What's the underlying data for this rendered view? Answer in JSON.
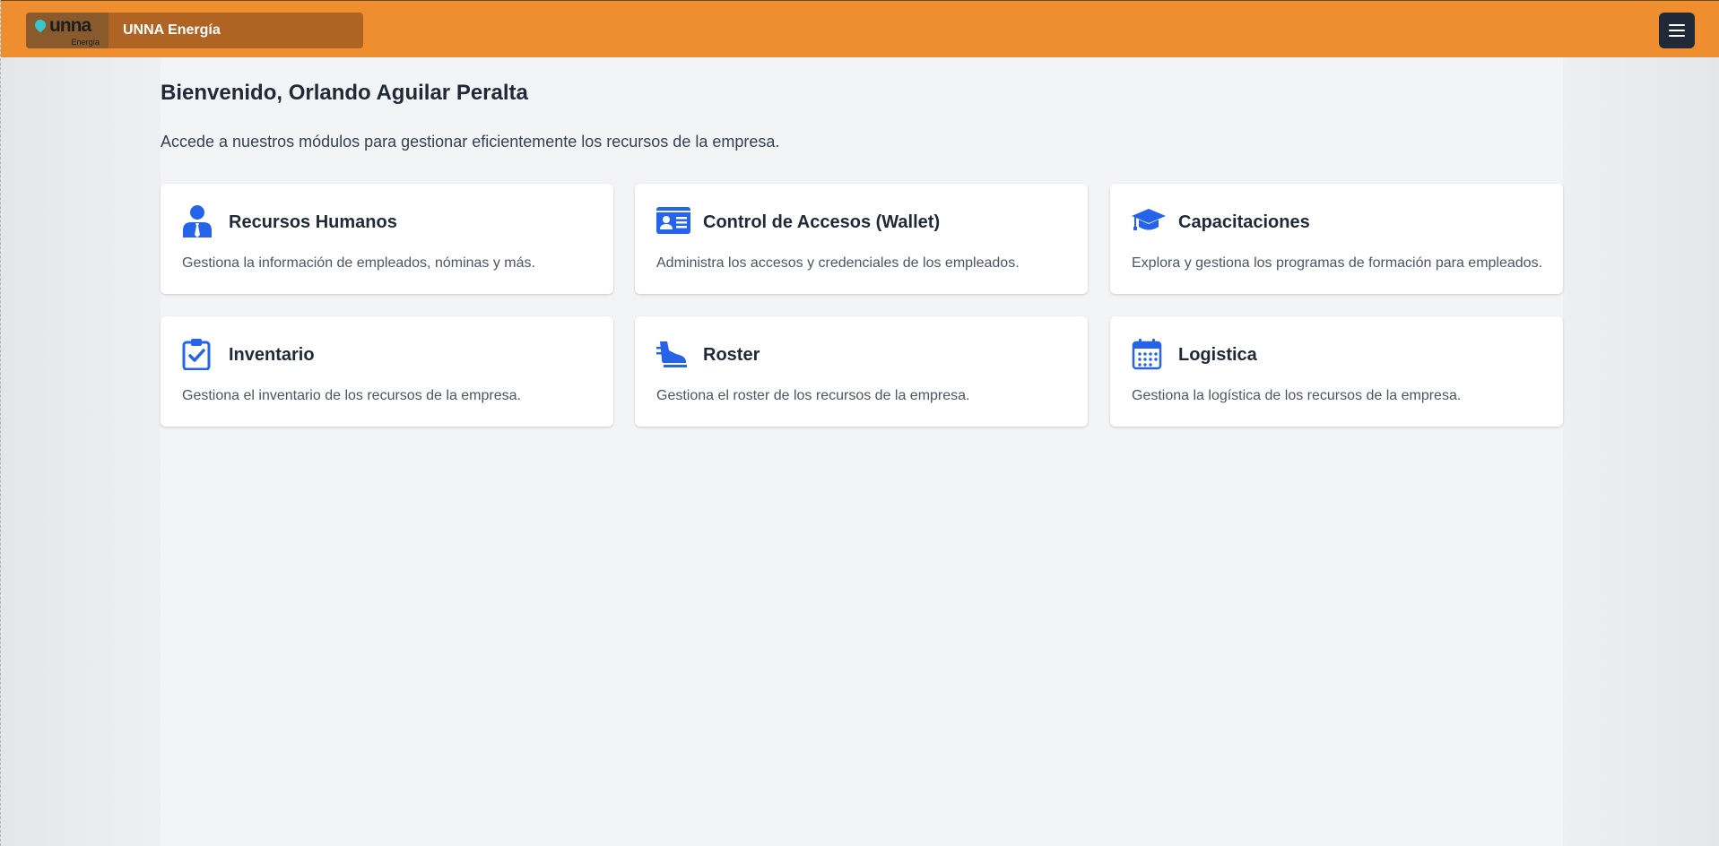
{
  "header": {
    "logo_text": "unna",
    "logo_subtext": "Energía",
    "brand_name": "UNNA Energía",
    "menu_icon": "hamburger-icon"
  },
  "main": {
    "welcome": "Bienvenido, Orlando Aguilar Peralta",
    "subtitle": "Accede a nuestros módulos para gestionar eficientemente los recursos de la empresa.",
    "modules": [
      {
        "title": "Recursos Humanos",
        "description": "Gestiona la información de empleados, nóminas y más.",
        "icon": "user-tie-icon"
      },
      {
        "title": "Control de Accesos (Wallet)",
        "description": "Administra los accesos y credenciales de los empleados.",
        "icon": "id-card-icon"
      },
      {
        "title": "Capacitaciones",
        "description": "Explora y gestiona los programas de formación para empleados.",
        "icon": "graduation-cap-icon"
      },
      {
        "title": "Inventario",
        "description": "Gestiona el inventario de los recursos de la empresa.",
        "icon": "clipboard-check-icon"
      },
      {
        "title": "Roster",
        "description": "Gestiona el roster de los recursos de la empresa.",
        "icon": "shoe-icon"
      },
      {
        "title": "Logistica",
        "description": "Gestiona la logística de los recursos de la empresa.",
        "icon": "calendar-icon"
      }
    ]
  },
  "colors": {
    "header_bg": "#ee8e2f",
    "brand_box_bg": "#b06424",
    "menu_button_bg": "#1f2937",
    "icon_blue": "#2563eb",
    "page_bg": "#f3f4f6"
  }
}
